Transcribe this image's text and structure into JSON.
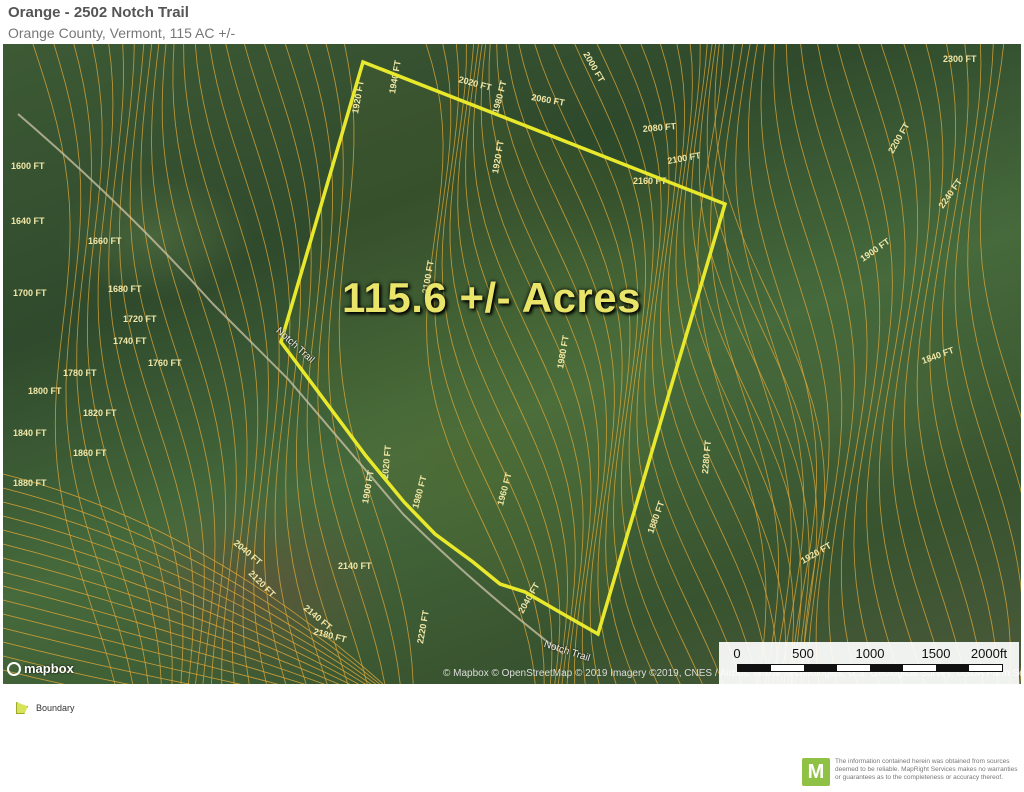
{
  "header": {
    "title": "Orange - 2502 Notch Trail",
    "subtitle": "Orange County, Vermont, 115 AC +/-"
  },
  "map": {
    "acreage_label": "115.6 +/- Acres",
    "road_label": "Notch Trail",
    "road_label_2": "Notch Trail",
    "contour_labels": [
      "2000 FT",
      "2300 FT",
      "2020 FT",
      "2060 FT",
      "1940 FT",
      "1920 FT",
      "1980 FT",
      "1920 FT",
      "2080 FT",
      "2100 FT",
      "2160 FT",
      "2200 FT",
      "2240 FT",
      "1600 FT",
      "1640 FT",
      "1660 FT",
      "1680 FT",
      "1700 FT",
      "1720 FT",
      "1740 FT",
      "1760 FT",
      "1780 FT",
      "1800 FT",
      "1820 FT",
      "1840 FT",
      "1860 FT",
      "1880 FT",
      "1900 FT",
      "1960 FT",
      "1980 FT",
      "2020 FT",
      "2040 FT",
      "2120 FT",
      "2140 FT",
      "2180 FT",
      "2220 FT",
      "2280 FT",
      "1880 FT",
      "1840 FT",
      "1900 FT",
      "1920 FT",
      "2040 FT",
      "2140 FT",
      "2100 FT",
      "1980 FT"
    ],
    "boundary_color": "#e8e82c",
    "contour_color": "#d9a43a",
    "attribution": "© Mapbox © OpenStreetMap © 2019 Imagery ©2019, CNES / Airbus, Maxar Technologies, U.S. Geological Survey, USDA Farm Service Agency",
    "logo_text": "mapbox"
  },
  "scale": {
    "labels": [
      "0",
      "500",
      "1000",
      "1500",
      "2000ft"
    ]
  },
  "legend": {
    "boundary_label": "Boundary",
    "boundary_color": "#d8e35a"
  },
  "footer": {
    "badge_letter": "M",
    "badge_color": "#8fc145",
    "disclaimer": "The information contained herein was obtained from sources deemed to be reliable. MapRight Services makes no warranties or guarantees as to the completeness or accuracy thereof."
  }
}
